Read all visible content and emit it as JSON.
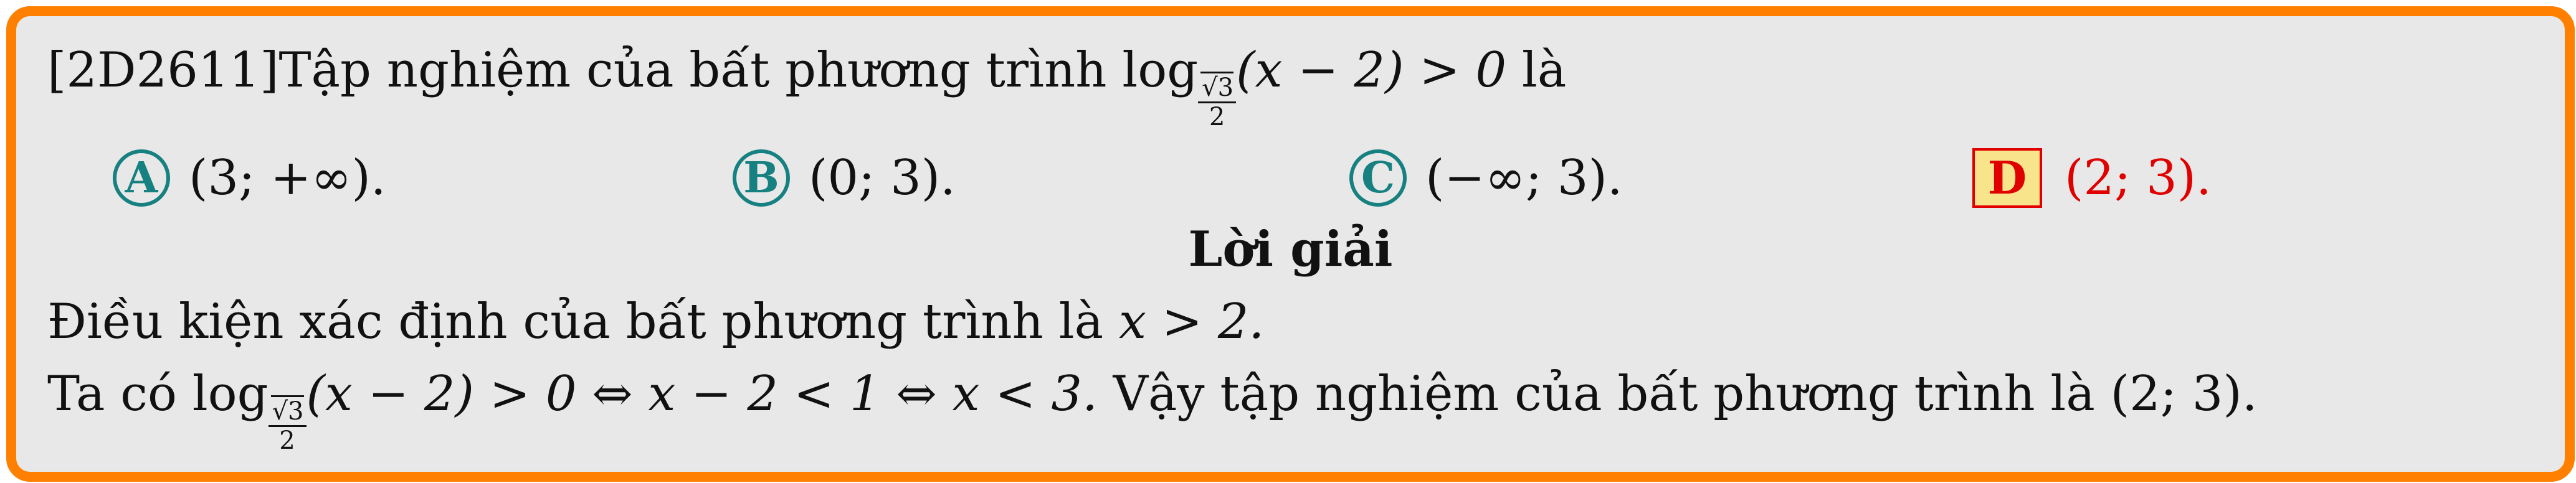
{
  "problem": {
    "code": "[2D2611]",
    "stem_text": "Tập nghiệm của bất phương trình",
    "log_word": "log",
    "log_base_num": "√3",
    "log_base_den": "2",
    "log_arg": "(x − 2) > 0",
    "stem_end": "là"
  },
  "options": [
    {
      "letter": "A",
      "text": "(3; +∞)."
    },
    {
      "letter": "B",
      "text": "(0; 3)."
    },
    {
      "letter": "C",
      "text": "(−∞; 3)."
    },
    {
      "letter": "D",
      "text": "(2; 3)."
    }
  ],
  "solution": {
    "heading": "Lời giải",
    "line1_text": "Điều kiện xác định của bất phương trình là",
    "line1_math": "x > 2.",
    "line2_start": "Ta có",
    "line2_log": "log",
    "line2_base_num": "√3",
    "line2_base_den": "2",
    "line2_math": "(x − 2) > 0 ⇔ x − 2 < 1 ⇔ x < 3.",
    "line2_end": "Vậy tập nghiệm của bất phương trình là (2; 3)."
  },
  "colors": {
    "border": "#ff8000",
    "background": "#e8e8e8",
    "option_badge": "#178080",
    "correct": "#e00000",
    "correct_fill": "#f8e48a"
  }
}
